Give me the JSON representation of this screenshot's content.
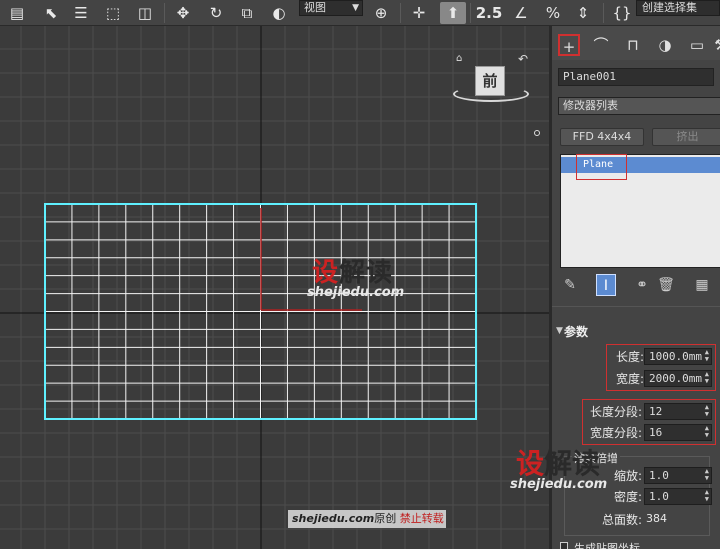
{
  "toolbar": {
    "view_combo": "视图",
    "selection_set": "创建选择集",
    "snap_label": "2.5"
  },
  "viewport": {
    "viewcube_face": "前",
    "watermark_brand_red": "设",
    "watermark_brand_rest": "解读",
    "watermark_url": "shejiedu.com",
    "credit_url": "shejiedu.com",
    "credit_original": "原创",
    "credit_forbid": "禁止转载",
    "plane": {
      "length_segs": 12,
      "width_segs": 16
    }
  },
  "panel": {
    "object_name": "Plane001",
    "modifier_list": "修改器列表",
    "btn_ffd": "FFD 4x4x4",
    "btn_extrude": "挤出",
    "stack_item": "Plane",
    "rollout_title": "参数",
    "params": {
      "length_label": "长度:",
      "length_value": "1000.0mm",
      "width_label": "宽度:",
      "width_value": "2000.0mm",
      "length_segs_label": "长度分段:",
      "length_segs_value": "12",
      "width_segs_label": "宽度分段:",
      "width_segs_value": "16",
      "render_group_title": "渲染倍增",
      "scale_label": "缩放:",
      "scale_value": "1.0",
      "density_label": "密度:",
      "density_value": "1.0",
      "total_faces_label": "总面数:",
      "total_faces_value": "384",
      "gen_mapping": "生成贴图坐标"
    }
  },
  "colors": {
    "accent_blue": "#5c8bd1",
    "highlight_red": "#d03030",
    "plane_cyan": "#5ff0ff"
  }
}
